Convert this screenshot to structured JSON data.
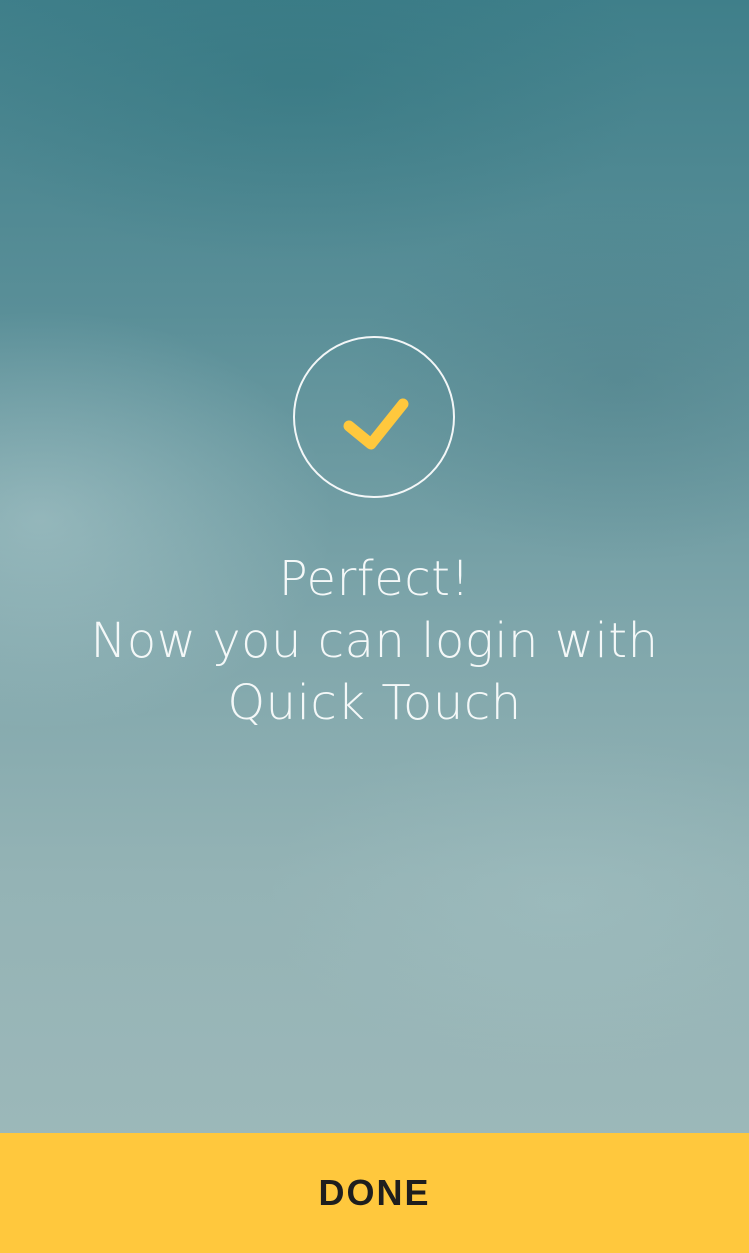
{
  "status": {
    "icon": "checkmark-icon",
    "check_color": "#ffc83d",
    "ring_color": "#ffffff"
  },
  "message": {
    "line1": "Perfect!",
    "line2": "Now you can login with",
    "line3": "Quick Touch"
  },
  "done_button": {
    "label": "DONE",
    "background": "#ffc83d"
  }
}
